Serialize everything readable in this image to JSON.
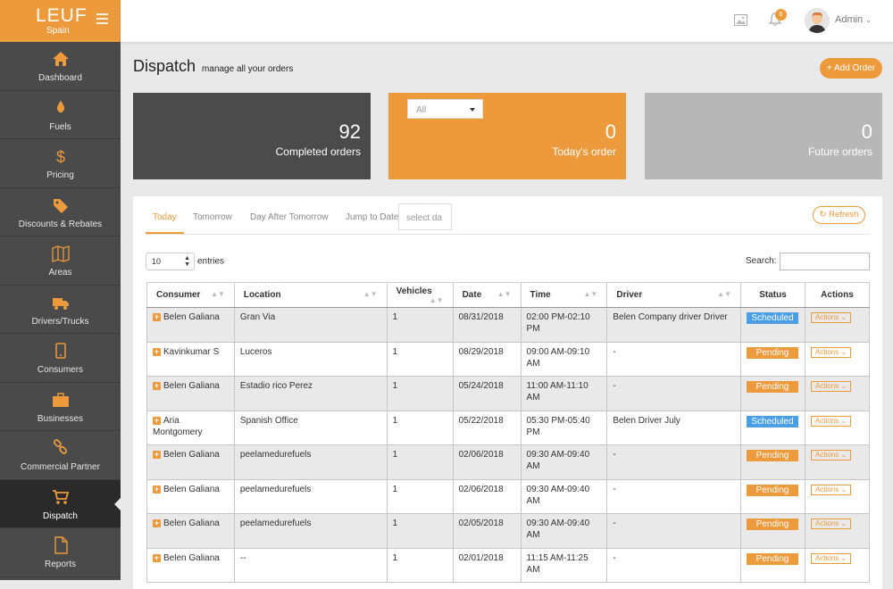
{
  "brand": {
    "name": "LEUF",
    "region": "Spain"
  },
  "sidebar": {
    "items": [
      {
        "label": "Dashboard",
        "icon": "home-icon"
      },
      {
        "label": "Fuels",
        "icon": "drop-icon"
      },
      {
        "label": "Pricing",
        "icon": "dollar-icon"
      },
      {
        "label": "Discounts & Rebates",
        "icon": "tag-icon"
      },
      {
        "label": "Areas",
        "icon": "map-icon"
      },
      {
        "label": "Drivers/Trucks",
        "icon": "truck-icon"
      },
      {
        "label": "Consumers",
        "icon": "phone-icon"
      },
      {
        "label": "Businesses",
        "icon": "briefcase-icon"
      },
      {
        "label": "Commercial Partner",
        "icon": "link-icon"
      },
      {
        "label": "Dispatch",
        "icon": "cart-icon",
        "active": true
      },
      {
        "label": "Reports",
        "icon": "document-icon"
      }
    ]
  },
  "header": {
    "notification_count": "6",
    "user": "Admin"
  },
  "page": {
    "title": "Dispatch",
    "subtitle": "manage all your orders",
    "add_label": "+ Add Order"
  },
  "cards": {
    "completed": {
      "value": "92",
      "label": "Completed orders"
    },
    "today": {
      "value": "0",
      "label": "Today's order",
      "filter": "All"
    },
    "future": {
      "value": "0",
      "label": "Future orders"
    }
  },
  "tabs": {
    "today": "Today",
    "tomorrow": "Tomorrow",
    "after": "Day After Tomorrow",
    "jump": "Jump to Date",
    "date_placeholder": "select da"
  },
  "refresh_label": "Refresh",
  "entries": {
    "value": "10",
    "label": "entries"
  },
  "search_label": "Search:",
  "table": {
    "headers": [
      "Consumer",
      "Location",
      "Vehicles",
      "Date",
      "Time",
      "Driver",
      "Status",
      "Actions"
    ],
    "action_label": "Actions",
    "rows": [
      {
        "consumer": "Belen Galiana",
        "location": "Gran Via",
        "vehicles": "1",
        "date": "08/31/2018",
        "time": "02:00 PM-02:10 PM",
        "driver": "Belen Company driver Driver",
        "status": "Scheduled"
      },
      {
        "consumer": "Kavinkumar S",
        "location": "Luceros",
        "vehicles": "1",
        "date": "08/29/2018",
        "time": "09:00 AM-09:10 AM",
        "driver": "-",
        "status": "Pending"
      },
      {
        "consumer": "Belen Galiana",
        "location": "Estadio rico Perez",
        "vehicles": "1",
        "date": "05/24/2018",
        "time": "11:00 AM-11:10 AM",
        "driver": "-",
        "status": "Pending"
      },
      {
        "consumer": "Aria Montgomery",
        "location": "Spanish Office",
        "vehicles": "1",
        "date": "05/22/2018",
        "time": "05:30 PM-05:40 PM",
        "driver": "Belen Driver July",
        "status": "Scheduled"
      },
      {
        "consumer": "Belen Galiana",
        "location": "peelamedurefuels",
        "vehicles": "1",
        "date": "02/06/2018",
        "time": "09:30 AM-09:40 AM",
        "driver": "-",
        "status": "Pending"
      },
      {
        "consumer": "Belen Galiana",
        "location": "peelamedurefuels",
        "vehicles": "1",
        "date": "02/06/2018",
        "time": "09:30 AM-09:40 AM",
        "driver": "-",
        "status": "Pending"
      },
      {
        "consumer": "Belen Galiana",
        "location": "peelamedurefuels",
        "vehicles": "1",
        "date": "02/05/2018",
        "time": "09:30 AM-09:40 AM",
        "driver": "-",
        "status": "Pending"
      },
      {
        "consumer": "Belen Galiana",
        "location": "--",
        "vehicles": "1",
        "date": "02/01/2018",
        "time": "11:15 AM-11:25 AM",
        "driver": "-",
        "status": "Pending"
      }
    ]
  }
}
